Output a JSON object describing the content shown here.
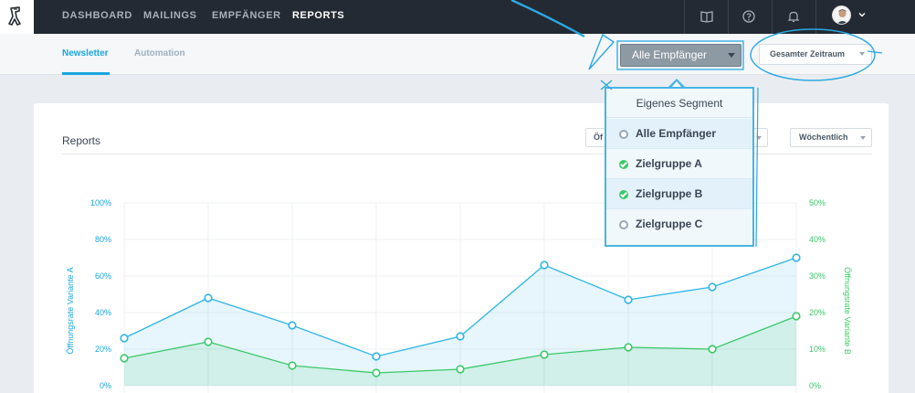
{
  "nav": {
    "items": [
      {
        "label": "DASHBOARD",
        "active": false
      },
      {
        "label": "MAILINGS",
        "active": false
      },
      {
        "label": "EMPFÄNGER",
        "active": false
      },
      {
        "label": "REPORTS",
        "active": true
      }
    ],
    "icons": [
      "book-icon",
      "help-icon",
      "bell-icon"
    ]
  },
  "subnav": {
    "tabs": [
      {
        "label": "Newsletter",
        "active": true
      },
      {
        "label": "Automation",
        "active": false
      }
    ]
  },
  "filters": {
    "recipients": "Alle Empfänger",
    "period": "Gesamter Zeitraum"
  },
  "card": {
    "title": "Reports",
    "metric_select_visible": "Öf",
    "interval_select": "Wöchentlich"
  },
  "dropdown": {
    "header": "Eigenes Segment",
    "options": [
      {
        "label": "Alle Empfänger",
        "checked": false
      },
      {
        "label": "Zielgruppe A",
        "checked": true
      },
      {
        "label": "Zielgruppe B",
        "checked": true
      },
      {
        "label": "Zielgruppe C",
        "checked": false
      }
    ]
  },
  "colors": {
    "accent": "#1aa6e0",
    "series_a": "#2fb5e5",
    "series_b": "#3cc869",
    "nav_bg": "#232a33"
  },
  "chart_data": {
    "type": "line",
    "left_axis": {
      "label": "Öffnungsrate Variante A",
      "ticks": [
        "100%",
        "80%",
        "60%",
        "40%",
        "20%",
        "0%"
      ],
      "range": [
        0,
        100
      ]
    },
    "right_axis": {
      "label": "Öffnungsrate Variante B",
      "ticks": [
        "50%",
        "40%",
        "30%",
        "20%",
        "10%",
        "0%"
      ],
      "range": [
        0,
        50
      ]
    },
    "grid": true,
    "series": [
      {
        "axis": "left",
        "values": [
          26,
          48,
          33,
          16,
          27,
          66,
          47,
          54,
          70
        ]
      },
      {
        "axis": "right",
        "values": [
          7.5,
          12,
          5.5,
          3.5,
          4.5,
          8.5,
          10.5,
          10,
          19
        ]
      }
    ]
  }
}
